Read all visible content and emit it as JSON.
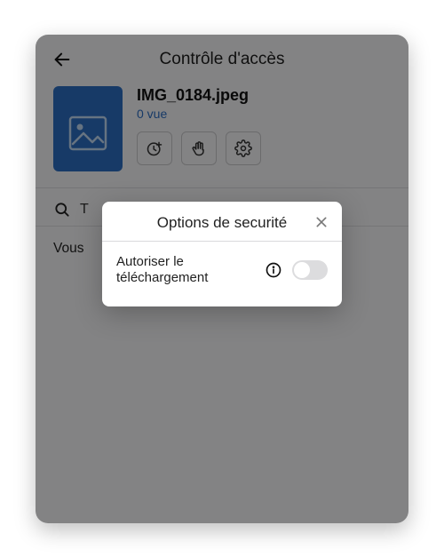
{
  "header": {
    "title": "Contrôle d'accès"
  },
  "file": {
    "name": "IMG_0184.jpeg",
    "views": "0 vue"
  },
  "search": {
    "placeholder_snippet": "T"
  },
  "body": {
    "partial_text": "Vous "
  },
  "dialog": {
    "title": "Options de securité",
    "option_label": "Autoriser le téléchargement",
    "toggle_on": false
  }
}
